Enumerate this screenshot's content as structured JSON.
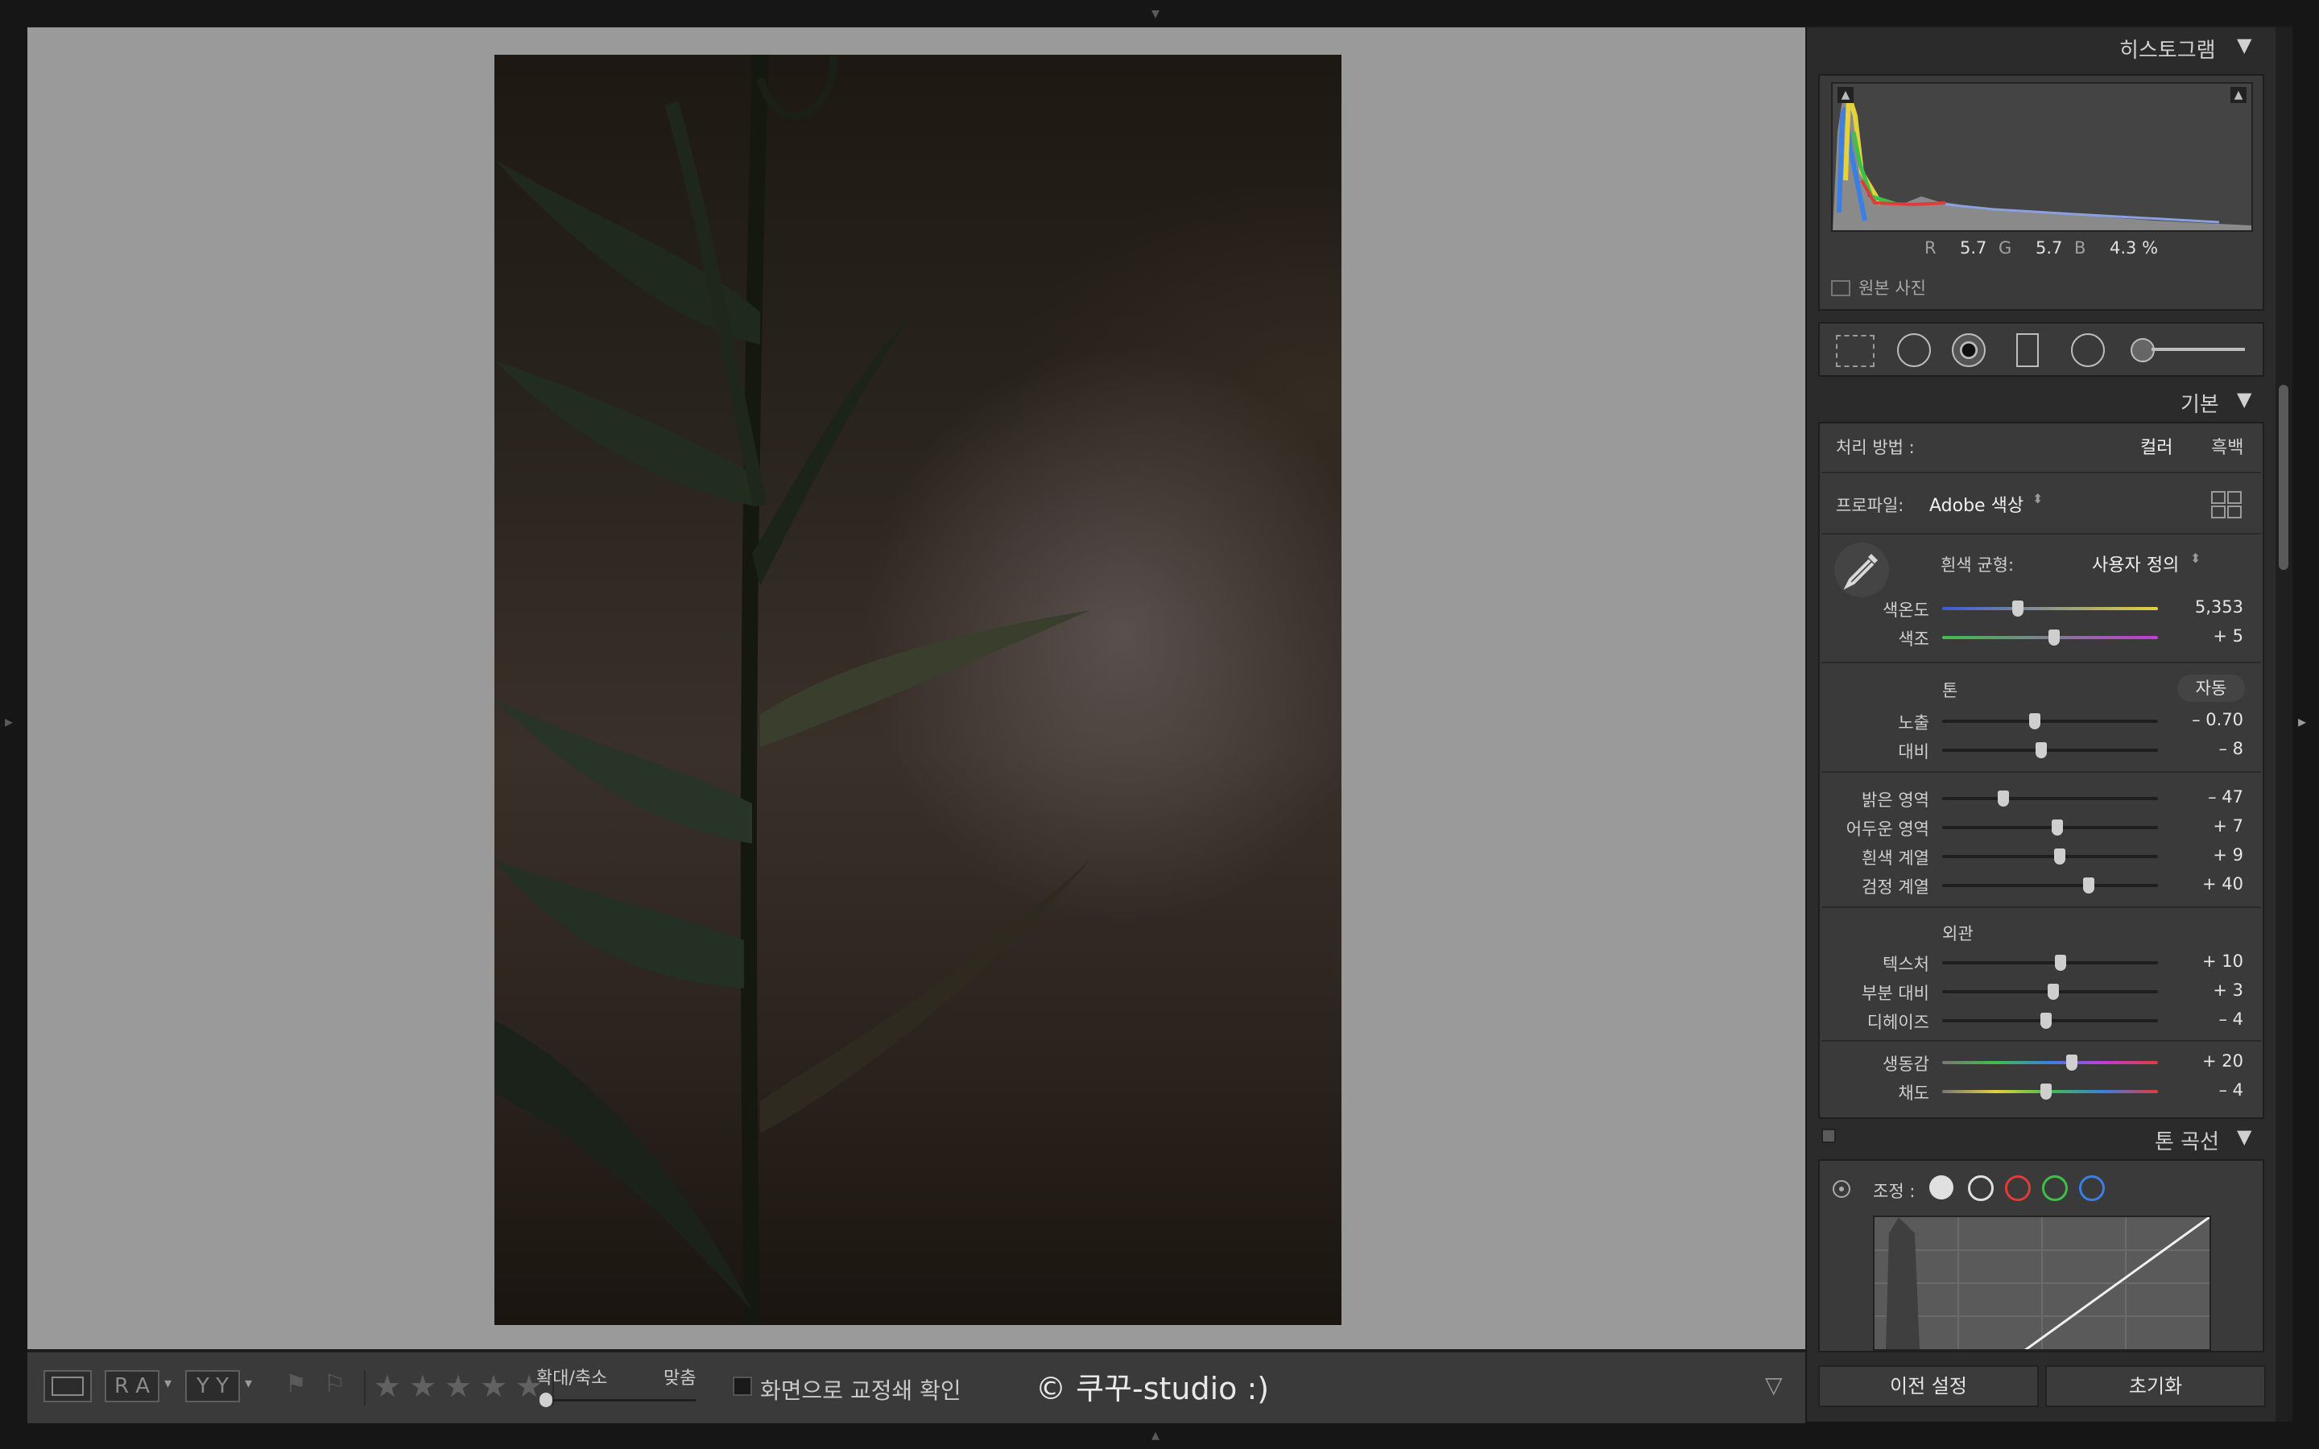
{
  "photo": {
    "watermark": "© 쿠꾸-studio :)"
  },
  "toolbar": {
    "view_ra": "R A",
    "view_yy": "Y Y",
    "zoom_label": "확대/축소",
    "fit_label": "맞춤",
    "proof_label": "화면으로 교정쇄 확인",
    "stars": [
      "★",
      "★",
      "★",
      "★",
      "★"
    ]
  },
  "histogram": {
    "title": "히스토그램",
    "r_label": "R",
    "r": "5.7",
    "g_label": "G",
    "g": "5.7",
    "b_label": "B",
    "b": "4.3 %",
    "original_label": "원본 사진"
  },
  "basic": {
    "title": "기본",
    "treatment_label": "처리 방법 :",
    "color": "컬러",
    "bw": "흑백",
    "profile_label": "프로파일:",
    "profile_value": "Adobe 색상",
    "wb_label": "흰색 균형:",
    "wb_value": "사용자 정의",
    "temp_label": "색온도",
    "temp_value": "5,353",
    "temp_pos": 0.35,
    "tint_label": "색조",
    "tint_value": "+ 5",
    "tint_pos": 0.52,
    "tone_label": "톤",
    "auto": "자동",
    "exposure_label": "노출",
    "exposure_value": "– 0.70",
    "exposure_pos": 0.43,
    "contrast_label": "대비",
    "contrast_value": "– 8",
    "contrast_pos": 0.46,
    "highlights_label": "밝은 영역",
    "highlights_value": "– 47",
    "highlights_pos": 0.285,
    "shadows_label": "어두운 영역",
    "shadows_value": "+ 7",
    "shadows_pos": 0.535,
    "whites_label": "흰색 계열",
    "whites_value": "+ 9",
    "whites_pos": 0.545,
    "blacks_label": "검정 계열",
    "blacks_value": "+ 40",
    "blacks_pos": 0.68,
    "presence_label": "외관",
    "texture_label": "텍스처",
    "texture_value": "+ 10",
    "texture_pos": 0.55,
    "clarity_label": "부분 대비",
    "clarity_value": "+ 3",
    "clarity_pos": 0.515,
    "dehaze_label": "디헤이즈",
    "dehaze_value": "– 4",
    "dehaze_pos": 0.48,
    "vibrance_label": "생동감",
    "vibrance_value": "+ 20",
    "vibrance_pos": 0.6,
    "saturation_label": "채도",
    "saturation_value": "– 4",
    "saturation_pos": 0.48
  },
  "tone_curve": {
    "title": "톤 곡선",
    "adjust_label": "조정 :"
  },
  "buttons": {
    "previous": "이전 설정",
    "reset": "초기화"
  },
  "colors": {
    "panel": "#3a3a3a",
    "canvas": "#9a9a9a",
    "accent_red": "#e23b3b",
    "accent_green": "#3fbf4a",
    "accent_blue": "#3b7fe2"
  }
}
